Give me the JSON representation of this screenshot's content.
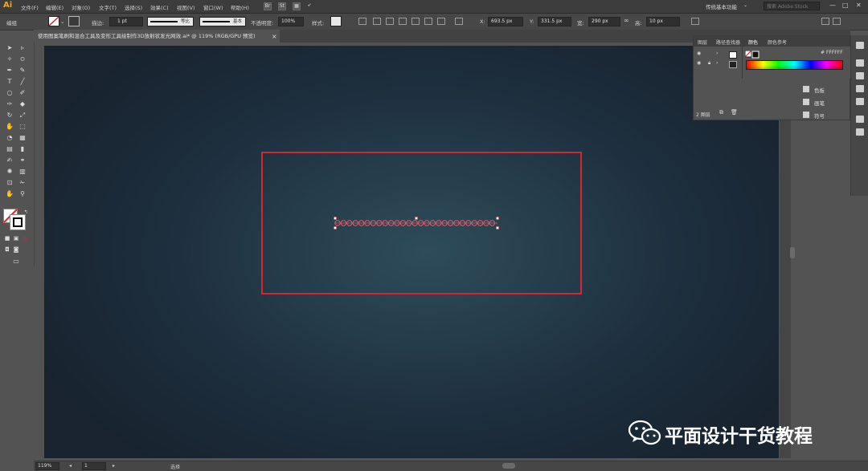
{
  "app": {
    "logo": "Ai",
    "menus": [
      "文件(F)",
      "编辑(E)",
      "对象(O)",
      "文字(T)",
      "选择(S)",
      "效果(C)",
      "视图(V)",
      "窗口(W)",
      "帮助(H)"
    ],
    "workspace": "传统基本功能",
    "search_placeholder": "搜索 Adobe Stock",
    "window_controls": [
      "—",
      "□",
      "✕"
    ]
  },
  "controlbar": {
    "selection_label": "编组",
    "stroke_label": "描边:",
    "stroke_weight": "1 pt",
    "stroke_profile": "等比",
    "brush": "基本",
    "opacity_label": "不透明度:",
    "opacity_value": "100%",
    "style_label": "样式:",
    "x_label": "X:",
    "x_value": "693.5 px",
    "y_label": "Y:",
    "y_value": "331.5 px",
    "w_label": "宽:",
    "w_value": "290 px",
    "h_label": "高:",
    "h_value": "10 px"
  },
  "document": {
    "tab_title": "使用图案笔刷和混合工具及变形工具绘制作3D放射状发光网效.ai* @ 119% (RGB/GPU 预览)",
    "close_glyph": "×"
  },
  "panel": {
    "tabs": [
      "图层",
      "路径查找器",
      "颜色",
      "颜色参考"
    ],
    "active_tab": "颜色",
    "hex_value": "FFFFFF",
    "layers_count": "2 图层",
    "sub_items": [
      "色板",
      "画笔",
      "符号"
    ]
  },
  "statusbar": {
    "zoom": "119%",
    "page": "1",
    "tool_status": "选择"
  },
  "watermark": {
    "text": "平面设计干货教程"
  },
  "colors": {
    "accent_red": "#d7262e",
    "canvas_center": "#2e4c5a",
    "canvas_edge": "#18232f"
  }
}
